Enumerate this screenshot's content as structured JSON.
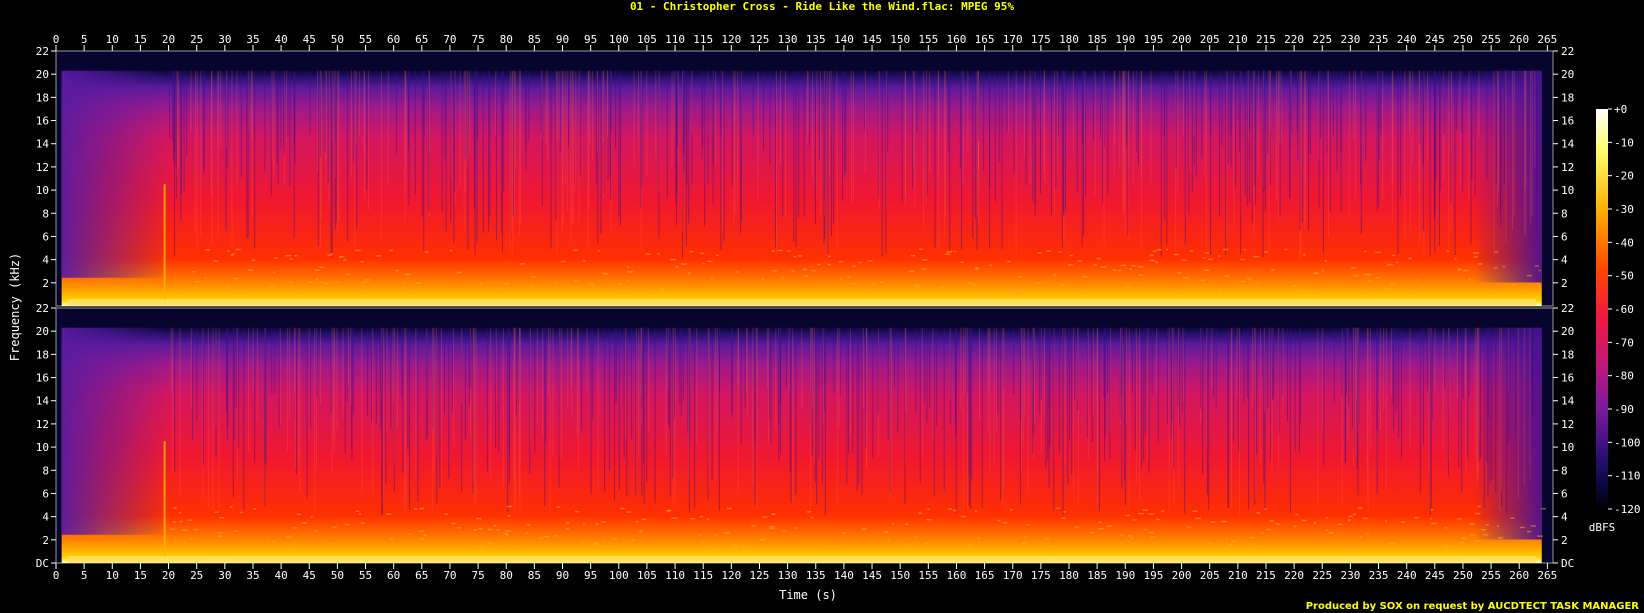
{
  "chart_data": {
    "type": "heatmap",
    "title": "01 - Christopher Cross - Ride Like the Wind.flac: MPEG 95%",
    "xlabel": "Time (s)",
    "ylabel": "Frequency (kHz)",
    "xlim": [
      0,
      266
    ],
    "x_ticks": [
      "0",
      "5",
      "10",
      "15",
      "20",
      "25",
      "30",
      "35",
      "40",
      "45",
      "50",
      "55",
      "60",
      "65",
      "70",
      "75",
      "80",
      "85",
      "90",
      "95",
      "100",
      "105",
      "110",
      "115",
      "120",
      "125",
      "130",
      "135",
      "140",
      "145",
      "150",
      "155",
      "160",
      "165",
      "170",
      "175",
      "180",
      "185",
      "190",
      "195",
      "200",
      "205",
      "210",
      "215",
      "220",
      "225",
      "230",
      "235",
      "240",
      "245",
      "250",
      "255",
      "260",
      "265"
    ],
    "ylim": [
      0,
      22
    ],
    "y_ticks": [
      "DC",
      "2",
      "4",
      "6",
      "8",
      "10",
      "12",
      "14",
      "16",
      "18",
      "20",
      "22"
    ],
    "channels": [
      {
        "name": "channel-1",
        "lowpass_khz": 20.3,
        "track_start_s": 1,
        "track_end_s": 264,
        "full_band_start_s": 20
      },
      {
        "name": "channel-2",
        "lowpass_khz": 20.3,
        "track_start_s": 1,
        "track_end_s": 264,
        "full_band_start_s": 20
      }
    ],
    "colorbar": {
      "unit": "dBFS",
      "ticks": [
        "+0",
        "-10",
        "-20",
        "-30",
        "-40",
        "-50",
        "-60",
        "-70",
        "-80",
        "-90",
        "-100",
        "-110",
        "-120"
      ],
      "range": [
        -120,
        0
      ]
    }
  },
  "footer": {
    "credit": "Produced by SOX on request by AUCDTECT TASK MANAGER"
  },
  "colors": {
    "title": "#ffff00",
    "text": "#ffffff",
    "grid": "#ffffff",
    "background": "#000000"
  }
}
